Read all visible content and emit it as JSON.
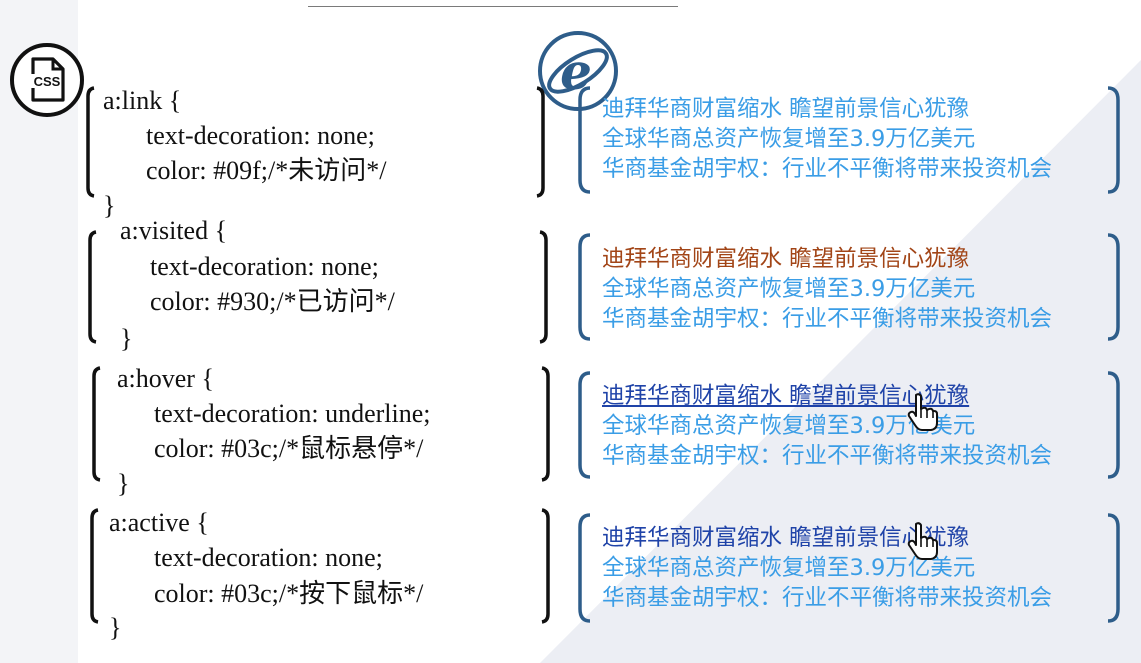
{
  "colors": {
    "unvisited": "#3a9de6",
    "visited": "#a24517",
    "hover": "#1f43a8",
    "active": "#1f43a8",
    "bracket_blue": "#2e5d8a",
    "background_shade": "#eceef4"
  },
  "icons": {
    "css_badge": "css-file-icon",
    "css_badge_text": "CSS",
    "browser_badge": "internet-explorer-icon",
    "cursor": "hand-pointer-icon"
  },
  "rules": [
    {
      "selector": "a:link {",
      "decl1": "text-decoration: none;",
      "decl2": "color: #09f;/*未访问*/",
      "close": "}"
    },
    {
      "selector": "a:visited {",
      "decl1": "text-decoration: none;",
      "decl2": "color: #930;/*已访问*/",
      "close": "}"
    },
    {
      "selector": "a:hover {",
      "decl1": "text-decoration: underline;",
      "decl2": "color: #03c;/*鼠标悬停*/",
      "close": "}"
    },
    {
      "selector": "a:active {",
      "decl1": "text-decoration: none;",
      "decl2": "color: #03c;/*按下鼠标*/",
      "close": "}"
    }
  ],
  "news": [
    "迪拜华商财富缩水 瞻望前景信心犹豫",
    "全球华商总资产恢复增至3.9万亿美元",
    "华商基金胡宇权：行业不平衡将带来投资机会"
  ]
}
